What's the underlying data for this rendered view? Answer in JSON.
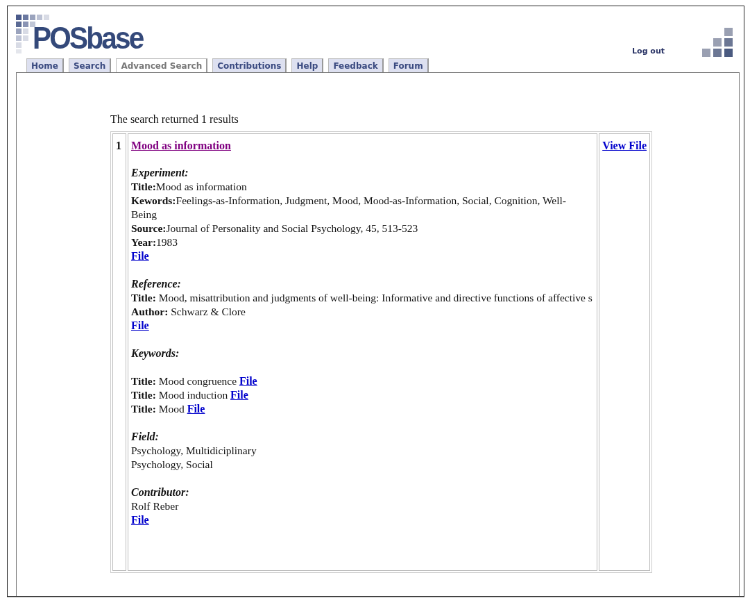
{
  "logo": {
    "text": "POSbase"
  },
  "tabs": [
    {
      "label": "Home",
      "selected": false
    },
    {
      "label": "Search",
      "selected": false
    },
    {
      "label": "Advanced Search",
      "selected": true
    },
    {
      "label": "Contributions",
      "selected": false
    },
    {
      "label": "Help",
      "selected": false
    },
    {
      "label": "Feedback",
      "selected": false
    },
    {
      "label": "Forum",
      "selected": false
    }
  ],
  "logout": "Log out",
  "summary": "The search returned 1 results",
  "results": [
    {
      "number": "1",
      "title": "Mood as information",
      "view_link": "View File",
      "sections": [
        {
          "heading": "Experiment:",
          "spaced": false,
          "lines": [
            {
              "kind": "text",
              "text": "**Title:**Mood as information"
            },
            {
              "kind": "text",
              "text": "**Kewords:**Feelings-as-Information, Judgment, Mood, Mood-as-Information, Social, Cognition, Well-Being"
            },
            {
              "kind": "text",
              "text": "**Source:**Journal of Personality and Social Psychology, 45, 513-523"
            },
            {
              "kind": "text",
              "text": "**Year:**1983"
            },
            {
              "kind": "link",
              "link": "File"
            }
          ]
        },
        {
          "heading": "Reference:",
          "spaced": false,
          "lines": [
            {
              "kind": "text",
              "text": "**Title:** Mood, misattribution and judgments of well-being: Informative and directive functions of affective s"
            },
            {
              "kind": "text",
              "text": "**Author:** Schwarz & Clore"
            },
            {
              "kind": "link",
              "link": "File"
            }
          ]
        },
        {
          "heading": "Keywords:",
          "spaced": true,
          "lines": [
            {
              "kind": "text_link",
              "text": "**Title:** Mood congruence",
              "link": "File"
            },
            {
              "kind": "text_link",
              "text": "**Title:** Mood induction",
              "link": "File"
            },
            {
              "kind": "text_link",
              "text": "**Title:** Mood",
              "link": "File"
            }
          ]
        },
        {
          "heading": "Field:",
          "spaced": false,
          "lines": [
            {
              "kind": "text",
              "text": "Psychology, Multidiciplinary"
            },
            {
              "kind": "text",
              "text": "Psychology, Social"
            }
          ]
        },
        {
          "heading": "Contributor:",
          "spaced": false,
          "lines": [
            {
              "kind": "text",
              "text": "Rolf Reber"
            },
            {
              "kind": "link",
              "link": "File"
            }
          ]
        }
      ]
    }
  ]
}
